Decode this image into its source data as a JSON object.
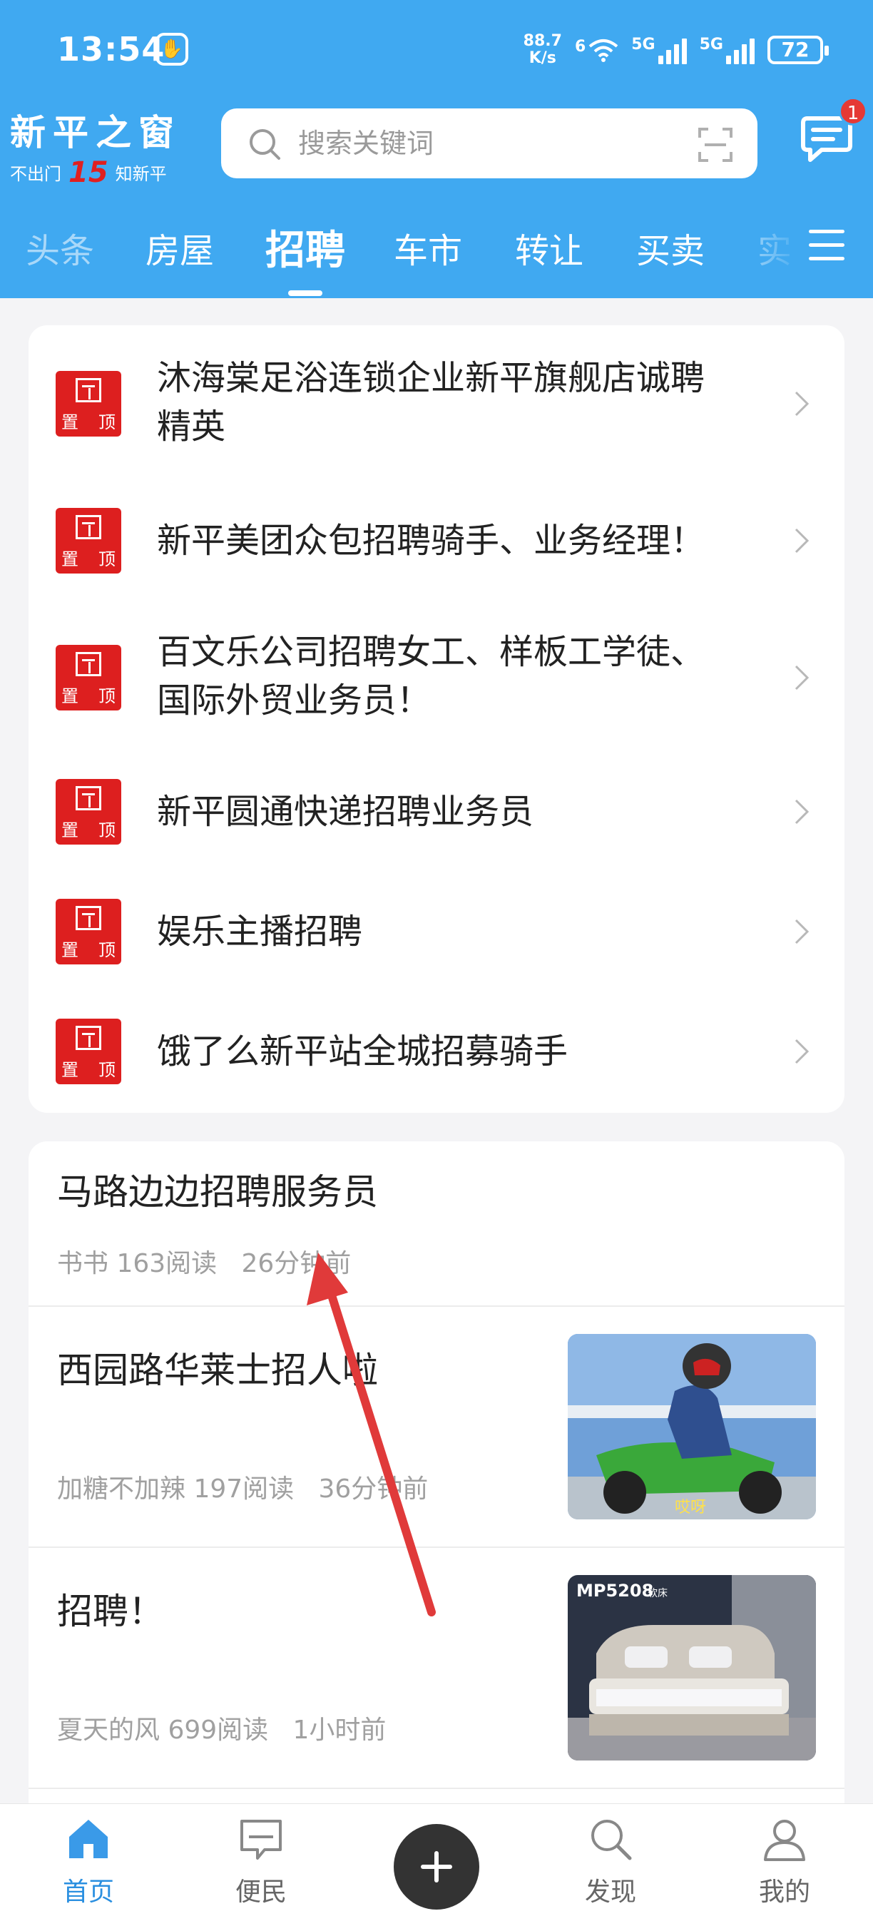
{
  "status_bar": {
    "time": "13:54",
    "net_speed_value": "88.7",
    "net_speed_unit": "K/s",
    "wifi_label": "6",
    "signal1_label": "5G",
    "signal2_label": "5G",
    "battery": "72"
  },
  "header": {
    "logo_title": "新平之窗",
    "logo_left": "不出门",
    "logo_number": "15",
    "logo_right": "知新平",
    "search_placeholder": "搜索关键词",
    "message_badge": "1"
  },
  "tabs": [
    {
      "label": "头条"
    },
    {
      "label": "房屋"
    },
    {
      "label": "招聘"
    },
    {
      "label": "车市"
    },
    {
      "label": "转让"
    },
    {
      "label": "买卖"
    },
    {
      "label": "实"
    }
  ],
  "active_tab": "招聘",
  "pin_badge": {
    "top": "置",
    "bottom": "顶"
  },
  "pinned": [
    {
      "title_line1": "沐海棠足浴连锁企业新平旗舰店诚聘",
      "title_line2": "精英"
    },
    {
      "title_line1": "新平美团众包招聘骑手、业务经理！",
      "title_line2": ""
    },
    {
      "title_line1": "百文乐公司招聘女工、样板工学徒、",
      "title_line2": "国际外贸业务员！"
    },
    {
      "title_line1": "新平圆通快递招聘业务员",
      "title_line2": ""
    },
    {
      "title_line1": " 娱乐主播招聘",
      "title_line2": ""
    },
    {
      "title_line1": "饿了么新平站全城招募骑手",
      "title_line2": ""
    }
  ],
  "feed": [
    {
      "title": "马路边边招聘服务员",
      "meta": "书书 163阅读   26分钟前"
    },
    {
      "title": "西园路华莱士招人啦",
      "meta": "加糖不加辣 197阅读   36分钟前",
      "thumb_label": "哎呀"
    },
    {
      "title": "招聘！",
      "meta": "夏天的风 699阅读   1小时前",
      "thumb_label": "MP5208",
      "thumb_sub": "软床"
    }
  ],
  "bottom_nav": {
    "home": "首页",
    "convenience": "便民",
    "discover": "发现",
    "mine": "我的"
  },
  "colors": {
    "header_blue": "#40a9f1",
    "pin_red": "#dd1f1f",
    "annotation_red": "#e03a3a",
    "active_nav": "#2a8fe0"
  }
}
